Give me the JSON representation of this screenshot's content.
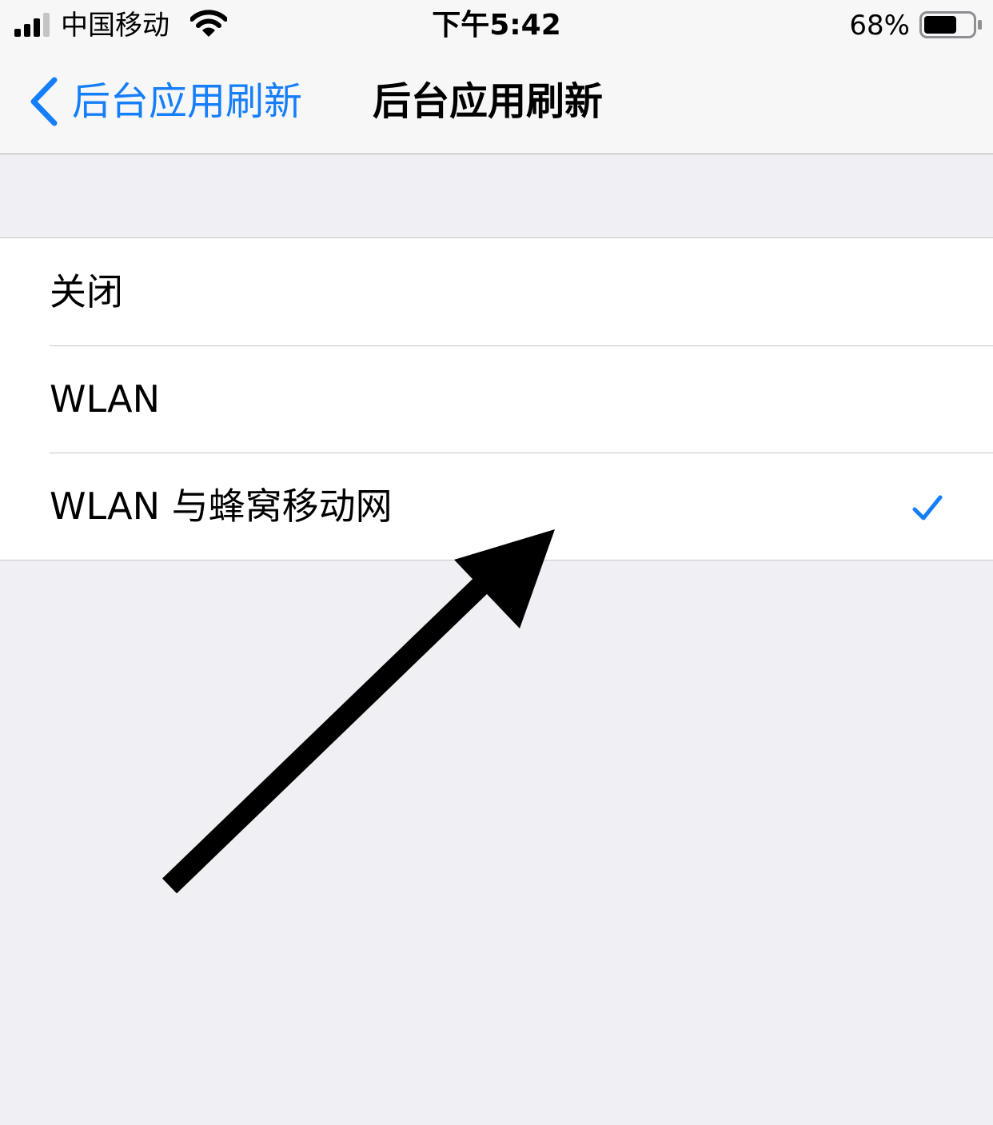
{
  "status_bar": {
    "carrier": "中国移动",
    "time": "下午5:42",
    "battery_percent": "68%",
    "battery_level": 0.68,
    "signal_icon": "signal-bars-icon",
    "wifi_icon": "wifi-icon",
    "battery_icon": "battery-icon"
  },
  "nav": {
    "back_label": "后台应用刷新",
    "title": "后台应用刷新",
    "back_icon": "chevron-left-icon"
  },
  "options": [
    {
      "label": "关闭",
      "selected": false
    },
    {
      "label": "WLAN",
      "selected": false
    },
    {
      "label": "WLAN 与蜂窝移动网",
      "selected": true
    }
  ],
  "colors": {
    "accent": "#157efb",
    "background": "#efeff4",
    "cell": "#ffffff",
    "annotation_arrow": "#000000"
  }
}
